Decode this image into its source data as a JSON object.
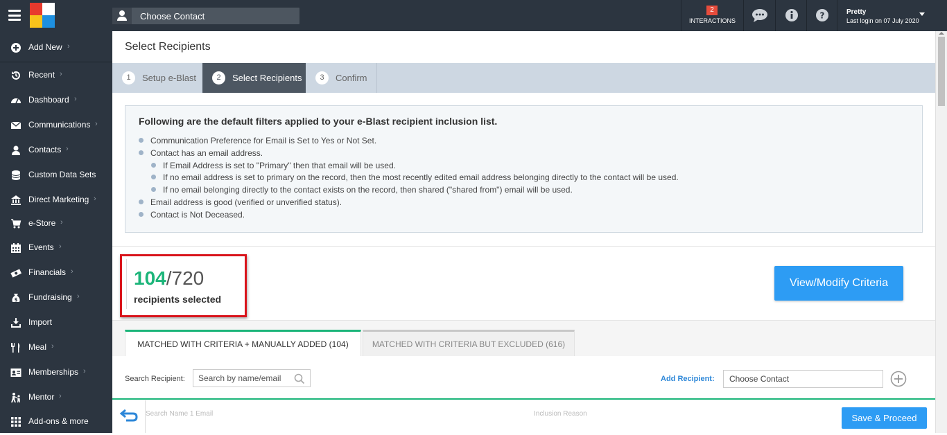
{
  "topbar": {
    "contact_picker": "Choose Contact",
    "interactions_count": "2",
    "interactions_label": "INTERACTIONS",
    "user_name": "Pretty",
    "last_login": "Last login on 07 July 2020"
  },
  "sidebar": {
    "items": [
      {
        "label": "Add New",
        "icon": "plus-circle-icon",
        "chevron": true
      },
      {
        "label": "Recent",
        "icon": "history-icon",
        "chevron": true
      },
      {
        "label": "Dashboard",
        "icon": "dashboard-icon",
        "chevron": true
      },
      {
        "label": "Communications",
        "icon": "envelope-icon",
        "chevron": true
      },
      {
        "label": "Contacts",
        "icon": "user-icon",
        "chevron": true
      },
      {
        "label": "Custom Data Sets",
        "icon": "database-icon",
        "chevron": false
      },
      {
        "label": "Direct Marketing",
        "icon": "bank-icon",
        "chevron": true
      },
      {
        "label": "e-Store",
        "icon": "cart-icon",
        "chevron": true
      },
      {
        "label": "Events",
        "icon": "calendar-icon",
        "chevron": true
      },
      {
        "label": "Financials",
        "icon": "money-icon",
        "chevron": true
      },
      {
        "label": "Fundraising",
        "icon": "money-bag-icon",
        "chevron": true
      },
      {
        "label": "Import",
        "icon": "import-icon",
        "chevron": false
      },
      {
        "label": "Meal",
        "icon": "cutlery-icon",
        "chevron": true
      },
      {
        "label": "Memberships",
        "icon": "id-card-icon",
        "chevron": true
      },
      {
        "label": "Mentor",
        "icon": "mentor-icon",
        "chevron": true
      },
      {
        "label": "Add-ons & more",
        "icon": "grid-icon",
        "chevron": false
      }
    ]
  },
  "page": {
    "title": "Select Recipients"
  },
  "steps": [
    {
      "num": "1",
      "label": "Setup e-Blast"
    },
    {
      "num": "2",
      "label": "Select Recipients"
    },
    {
      "num": "3",
      "label": "Confirm"
    }
  ],
  "filters": {
    "heading": "Following are the default filters applied to your e-Blast recipient inclusion list.",
    "lines": [
      "Communication Preference for Email is Set to Yes or Not Set.",
      "Contact has an email address.",
      "If Email Address is set to \"Primary\" then that email will be used.",
      "If no email address is set to primary on the record, then the most recently edited email address belonging directly to the contact will be used.",
      "If no email belonging directly to the contact exists on the record, then shared (\"shared from\") email will be used.",
      "Email address is good (verified or unverified status).",
      "Contact is Not Deceased."
    ]
  },
  "counter": {
    "selected": "104",
    "total": "/720",
    "label": "recipients selected"
  },
  "view_modify_label": "View/Modify Criteria",
  "tabs": [
    {
      "label": "MATCHED WITH CRITERIA + MANUALLY ADDED (104)"
    },
    {
      "label": "MATCHED WITH CRITERIA BUT EXCLUDED (616)"
    }
  ],
  "search": {
    "label": "Search Recipient:",
    "placeholder": "Search by name/email"
  },
  "add_recipient": {
    "label": "Add Recipient:",
    "placeholder": "Choose Contact"
  },
  "table": {
    "col1": "Search Name 1 Email",
    "col2": "Inclusion Reason"
  },
  "footer": {
    "save_label": "Save & Proceed"
  }
}
